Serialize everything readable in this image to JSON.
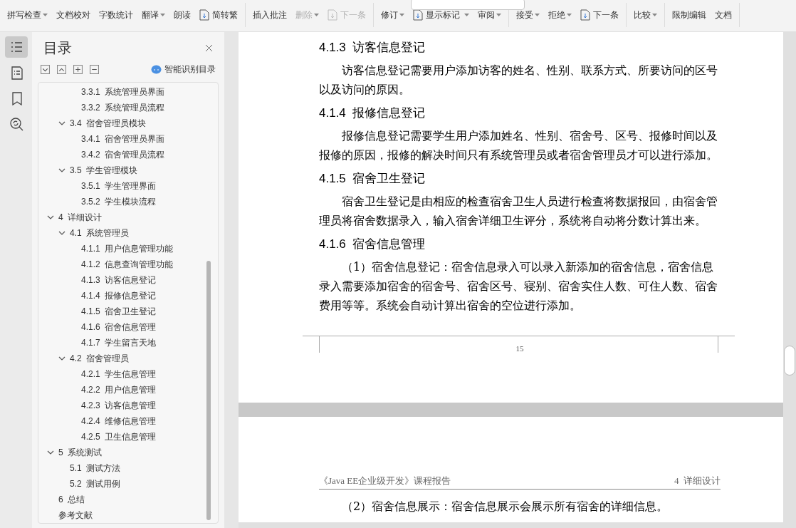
{
  "ribbon": [
    {
      "items": [
        {
          "kind": "large",
          "label": "拼写检查",
          "dropdown": true,
          "disabled": false
        },
        {
          "kind": "large",
          "label": "文档校对",
          "dropdown": false,
          "disabled": false
        },
        {
          "kind": "large",
          "label": "字数统计",
          "dropdown": false,
          "disabled": false
        },
        {
          "kind": "large",
          "label": "翻译",
          "dropdown": true,
          "disabled": false
        },
        {
          "kind": "large",
          "label": "朗读",
          "dropdown": false,
          "disabled": false
        },
        {
          "kind": "small",
          "label": "简转繁",
          "dropdown": false,
          "disabled": false
        }
      ]
    },
    {
      "items": [
        {
          "kind": "large",
          "label": "插入批注",
          "dropdown": false,
          "disabled": false
        },
        {
          "kind": "large",
          "label": "删除",
          "dropdown": true,
          "disabled": true
        },
        {
          "kind": "small",
          "label": "下一条",
          "dropdown": false,
          "disabled": true
        }
      ]
    },
    {
      "items": [
        {
          "kind": "large",
          "label": "修订",
          "dropdown": true,
          "disabled": false
        },
        {
          "kind": "field"
        },
        {
          "kind": "small",
          "label": "显示标记",
          "dropdown": true,
          "disabled": false
        },
        {
          "kind": "large",
          "label": "审阅",
          "dropdown": true,
          "disabled": false
        }
      ]
    },
    {
      "items": [
        {
          "kind": "large",
          "label": "接受",
          "dropdown": true,
          "disabled": false
        },
        {
          "kind": "large",
          "label": "拒绝",
          "dropdown": true,
          "disabled": false
        },
        {
          "kind": "small",
          "label": "下一条",
          "dropdown": false,
          "disabled": false
        }
      ]
    },
    {
      "items": [
        {
          "kind": "large",
          "label": "比较",
          "dropdown": true,
          "disabled": false
        }
      ]
    },
    {
      "items": [
        {
          "kind": "large",
          "label": "限制编辑",
          "dropdown": false,
          "disabled": false
        },
        {
          "kind": "large",
          "label": "文档",
          "dropdown": false,
          "disabled": false
        }
      ]
    }
  ],
  "rail": [
    {
      "selected": true
    },
    {
      "selected": false
    },
    {
      "selected": false
    },
    {
      "selected": false
    }
  ],
  "toc": {
    "title": "目录",
    "smart_button": "智能识别目录",
    "items": [
      {
        "children": [
          {
            "children": [
              {
                "label": "3.3.1  系统管理员界面"
              },
              {
                "label": "3.3.2  系统管理员流程"
              }
            ]
          },
          {
            "label": "3.4  宿舍管理员模块",
            "expanded": true,
            "children": [
              {
                "label": "3.4.1  宿舍管理员界面"
              },
              {
                "label": "3.4.2  宿舍管理员流程"
              }
            ]
          },
          {
            "label": "3.5  学生管理模块",
            "expanded": true,
            "children": [
              {
                "label": "3.5.1  学生管理界面"
              },
              {
                "label": "3.5.2  学生模块流程"
              }
            ]
          }
        ]
      },
      {
        "label": "4  详细设计",
        "expanded": true,
        "children": [
          {
            "label": "4.1  系统管理员",
            "expanded": true,
            "children": [
              {
                "label": "4.1.1  用户信息管理功能"
              },
              {
                "label": "4.1.2  信息查询管理功能"
              },
              {
                "label": "4.1.3  访客信息登记"
              },
              {
                "label": "4.1.4  报修信息登记"
              },
              {
                "label": "4.1.5  宿舍卫生登记"
              },
              {
                "label": "4.1.6  宿舍信息管理"
              },
              {
                "label": "4.1.7  学生留言天地"
              }
            ]
          },
          {
            "label": "4.2  宿舍管理员",
            "expanded": true,
            "children": [
              {
                "label": "4.2.1  学生信息管理"
              },
              {
                "label": "4.2.2  用户信息管理"
              },
              {
                "label": "4.2.3  访客信息管理"
              },
              {
                "label": "4.2.4  维修信息管理"
              },
              {
                "label": "4.2.5  卫生信息管理"
              }
            ]
          }
        ]
      },
      {
        "label": "5  系统测试",
        "expanded": true,
        "children": [
          {
            "label": "5.1  测试方法"
          },
          {
            "label": "5.2  测试用例"
          }
        ]
      },
      {
        "label": "6  总结"
      },
      {
        "label": "参考文献"
      }
    ]
  },
  "page1": {
    "blocks": [
      {
        "kind": "heading",
        "text": "4.1.3  访客信息登记"
      },
      {
        "kind": "paragraph",
        "text": "访客信息登记需要用户添加访客的姓名、性别、联系方式、所要访问的区号以及访问的原因。"
      },
      {
        "kind": "heading",
        "text": "4.1.4  报修信息登记"
      },
      {
        "kind": "paragraph",
        "text": "报修信息登记需要学生用户添加姓名、性别、宿舍号、区号、报修时间以及报修的原因，报修的解决时间只有系统管理员或者宿舍管理员才可以进行添加。"
      },
      {
        "kind": "heading",
        "text": "4.1.5  宿舍卫生登记"
      },
      {
        "kind": "paragraph",
        "text": "宿舍卫生登记是由相应的检查宿舍卫生人员进行检查将数据报回，由宿舍管理员将宿舍数据录入，输入宿舍详细卫生评分，系统将自动将分数计算出来。"
      },
      {
        "kind": "heading",
        "text": "4.1.6  宿舍信息管理"
      },
      {
        "kind": "paragraph",
        "text": "（1）宿舍信息登记：宿舍信息录入可以录入新添加的宿舍信息，宿舍信息录入需要添加宿舍的宿舍号、宿舍区号、寝别、宿舍实住人数、可住人数、宿舍费用等等。系统会自动计算出宿舍的空位进行添加。"
      }
    ],
    "page_number": "15"
  },
  "page2": {
    "header_left": "《Java EE企业级开发》课程报告",
    "header_right": "4  详细设计",
    "blocks": [
      {
        "kind": "paragraph",
        "text": "（2）宿舍信息展示：宿舍信息展示会展示所有宿舍的详细信息。"
      }
    ]
  }
}
